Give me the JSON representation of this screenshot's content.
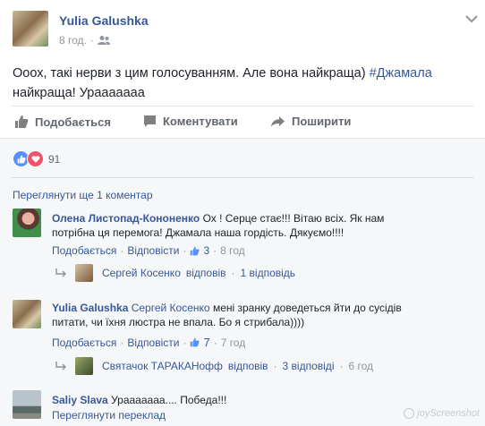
{
  "post": {
    "author": "Yulia Galushka",
    "time": "8 год.",
    "privacy_icon": "friends-icon",
    "text_part1": "Ооох, такі нерви з цим голосуванням. Але вона найкраща)",
    "hashtag": "#Джамала",
    "text_line2": "найкраща! Урааааааа"
  },
  "actions": {
    "like": "Подобається",
    "comment": "Коментувати",
    "share": "Поширити"
  },
  "reactions": {
    "count": "91"
  },
  "view_more": "Переглянути ще 1 коментар",
  "comments": [
    {
      "author": "Олена Листопад-Кононенко",
      "text": "Ох ! Серце стає!!! Вітаю всіх. Як нам потрібна ця перемога! Джамала наша гордість. Дякуємо!!!!",
      "like": "Подобається",
      "reply": "Відповісти",
      "likes": "3",
      "time": "8 год",
      "reply_summary_name": "Сергей Косенко",
      "reply_summary_action": "відповів",
      "reply_summary_count": "1 відповідь"
    },
    {
      "author": "Yulia Galushka",
      "mention": "Сергей Косенко",
      "text_rest": "мені зранку доведеться йти до сусідів питати, чи їхня люстра не впала. Бо я стрибала))))",
      "like": "Подобається",
      "reply": "Відповісти",
      "likes": "7",
      "time": "7 год",
      "reply_summary_name": "Святачок ТАРАКАНофф",
      "reply_summary_action": "відповів",
      "reply_summary_count": "3 відповіді",
      "reply_summary_time": "6 год"
    },
    {
      "author": "Saliy Slava",
      "text": "Урааааааа.... Победа!!!",
      "translate": "Переглянути переклад"
    }
  ],
  "watermark": "joyScreenshot"
}
